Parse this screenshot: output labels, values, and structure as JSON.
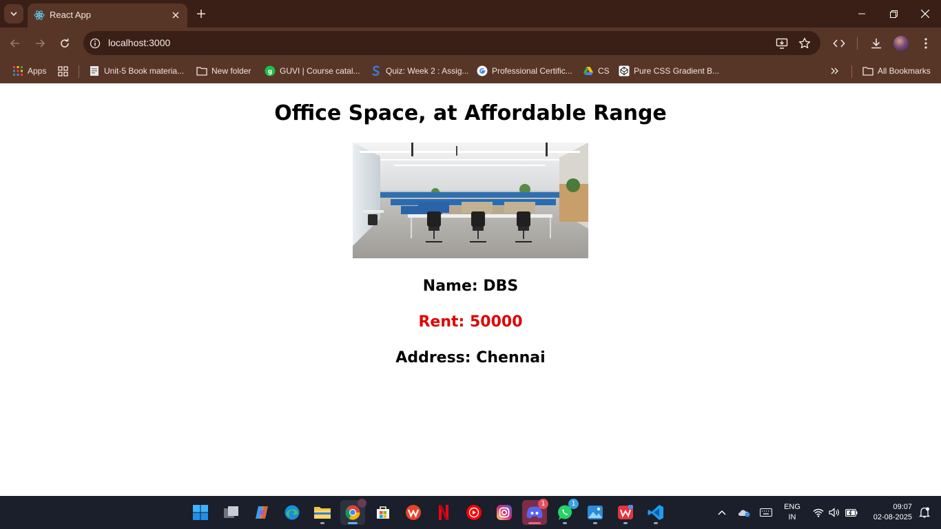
{
  "browser": {
    "tab_title": "React App",
    "url": "localhost:3000",
    "bookmarks": [
      {
        "label": "Apps"
      },
      {
        "label": "Unit-5 Book materia..."
      },
      {
        "label": "New folder"
      },
      {
        "label": "GUVI | Course catal..."
      },
      {
        "label": "Quiz: Week 2 : Assig..."
      },
      {
        "label": "Professional Certific..."
      },
      {
        "label": "CS"
      },
      {
        "label": "Pure CSS Gradient B..."
      }
    ],
    "all_bookmarks_label": "All Bookmarks"
  },
  "page": {
    "title": "Office Space, at Affordable Range",
    "name": "Name: DBS",
    "rent": "Rent: 50000",
    "address": "Address: Chennai",
    "rent_color": "#e00000"
  },
  "taskbar": {
    "lang_line1": "ENG",
    "lang_line2": "IN",
    "time": "09:07",
    "date": "02-08-2025",
    "discord_badge": "1",
    "whatsapp_badge": "1"
  }
}
